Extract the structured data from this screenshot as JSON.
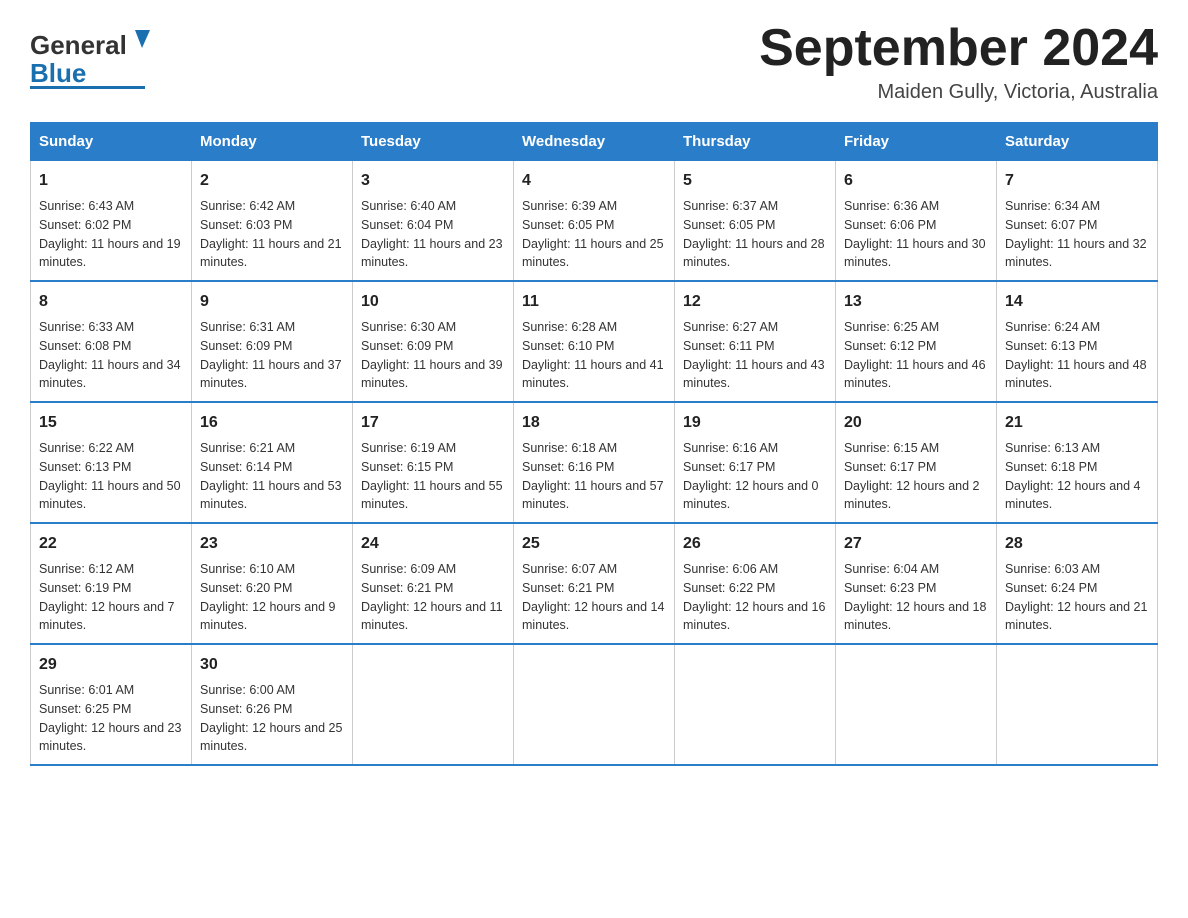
{
  "header": {
    "month_title": "September 2024",
    "location": "Maiden Gully, Victoria, Australia"
  },
  "logo": {
    "line1": "General",
    "line2": "Blue"
  },
  "days_of_week": [
    "Sunday",
    "Monday",
    "Tuesday",
    "Wednesday",
    "Thursday",
    "Friday",
    "Saturday"
  ],
  "weeks": [
    [
      {
        "day": "1",
        "sunrise": "6:43 AM",
        "sunset": "6:02 PM",
        "daylight": "11 hours and 19 minutes."
      },
      {
        "day": "2",
        "sunrise": "6:42 AM",
        "sunset": "6:03 PM",
        "daylight": "11 hours and 21 minutes."
      },
      {
        "day": "3",
        "sunrise": "6:40 AM",
        "sunset": "6:04 PM",
        "daylight": "11 hours and 23 minutes."
      },
      {
        "day": "4",
        "sunrise": "6:39 AM",
        "sunset": "6:05 PM",
        "daylight": "11 hours and 25 minutes."
      },
      {
        "day": "5",
        "sunrise": "6:37 AM",
        "sunset": "6:05 PM",
        "daylight": "11 hours and 28 minutes."
      },
      {
        "day": "6",
        "sunrise": "6:36 AM",
        "sunset": "6:06 PM",
        "daylight": "11 hours and 30 minutes."
      },
      {
        "day": "7",
        "sunrise": "6:34 AM",
        "sunset": "6:07 PM",
        "daylight": "11 hours and 32 minutes."
      }
    ],
    [
      {
        "day": "8",
        "sunrise": "6:33 AM",
        "sunset": "6:08 PM",
        "daylight": "11 hours and 34 minutes."
      },
      {
        "day": "9",
        "sunrise": "6:31 AM",
        "sunset": "6:09 PM",
        "daylight": "11 hours and 37 minutes."
      },
      {
        "day": "10",
        "sunrise": "6:30 AM",
        "sunset": "6:09 PM",
        "daylight": "11 hours and 39 minutes."
      },
      {
        "day": "11",
        "sunrise": "6:28 AM",
        "sunset": "6:10 PM",
        "daylight": "11 hours and 41 minutes."
      },
      {
        "day": "12",
        "sunrise": "6:27 AM",
        "sunset": "6:11 PM",
        "daylight": "11 hours and 43 minutes."
      },
      {
        "day": "13",
        "sunrise": "6:25 AM",
        "sunset": "6:12 PM",
        "daylight": "11 hours and 46 minutes."
      },
      {
        "day": "14",
        "sunrise": "6:24 AM",
        "sunset": "6:13 PM",
        "daylight": "11 hours and 48 minutes."
      }
    ],
    [
      {
        "day": "15",
        "sunrise": "6:22 AM",
        "sunset": "6:13 PM",
        "daylight": "11 hours and 50 minutes."
      },
      {
        "day": "16",
        "sunrise": "6:21 AM",
        "sunset": "6:14 PM",
        "daylight": "11 hours and 53 minutes."
      },
      {
        "day": "17",
        "sunrise": "6:19 AM",
        "sunset": "6:15 PM",
        "daylight": "11 hours and 55 minutes."
      },
      {
        "day": "18",
        "sunrise": "6:18 AM",
        "sunset": "6:16 PM",
        "daylight": "11 hours and 57 minutes."
      },
      {
        "day": "19",
        "sunrise": "6:16 AM",
        "sunset": "6:17 PM",
        "daylight": "12 hours and 0 minutes."
      },
      {
        "day": "20",
        "sunrise": "6:15 AM",
        "sunset": "6:17 PM",
        "daylight": "12 hours and 2 minutes."
      },
      {
        "day": "21",
        "sunrise": "6:13 AM",
        "sunset": "6:18 PM",
        "daylight": "12 hours and 4 minutes."
      }
    ],
    [
      {
        "day": "22",
        "sunrise": "6:12 AM",
        "sunset": "6:19 PM",
        "daylight": "12 hours and 7 minutes."
      },
      {
        "day": "23",
        "sunrise": "6:10 AM",
        "sunset": "6:20 PM",
        "daylight": "12 hours and 9 minutes."
      },
      {
        "day": "24",
        "sunrise": "6:09 AM",
        "sunset": "6:21 PM",
        "daylight": "12 hours and 11 minutes."
      },
      {
        "day": "25",
        "sunrise": "6:07 AM",
        "sunset": "6:21 PM",
        "daylight": "12 hours and 14 minutes."
      },
      {
        "day": "26",
        "sunrise": "6:06 AM",
        "sunset": "6:22 PM",
        "daylight": "12 hours and 16 minutes."
      },
      {
        "day": "27",
        "sunrise": "6:04 AM",
        "sunset": "6:23 PM",
        "daylight": "12 hours and 18 minutes."
      },
      {
        "day": "28",
        "sunrise": "6:03 AM",
        "sunset": "6:24 PM",
        "daylight": "12 hours and 21 minutes."
      }
    ],
    [
      {
        "day": "29",
        "sunrise": "6:01 AM",
        "sunset": "6:25 PM",
        "daylight": "12 hours and 23 minutes."
      },
      {
        "day": "30",
        "sunrise": "6:00 AM",
        "sunset": "6:26 PM",
        "daylight": "12 hours and 25 minutes."
      },
      {
        "day": "",
        "sunrise": "",
        "sunset": "",
        "daylight": ""
      },
      {
        "day": "",
        "sunrise": "",
        "sunset": "",
        "daylight": ""
      },
      {
        "day": "",
        "sunrise": "",
        "sunset": "",
        "daylight": ""
      },
      {
        "day": "",
        "sunrise": "",
        "sunset": "",
        "daylight": ""
      },
      {
        "day": "",
        "sunrise": "",
        "sunset": "",
        "daylight": ""
      }
    ]
  ],
  "labels": {
    "sunrise": "Sunrise:",
    "sunset": "Sunset:",
    "daylight": "Daylight:"
  }
}
